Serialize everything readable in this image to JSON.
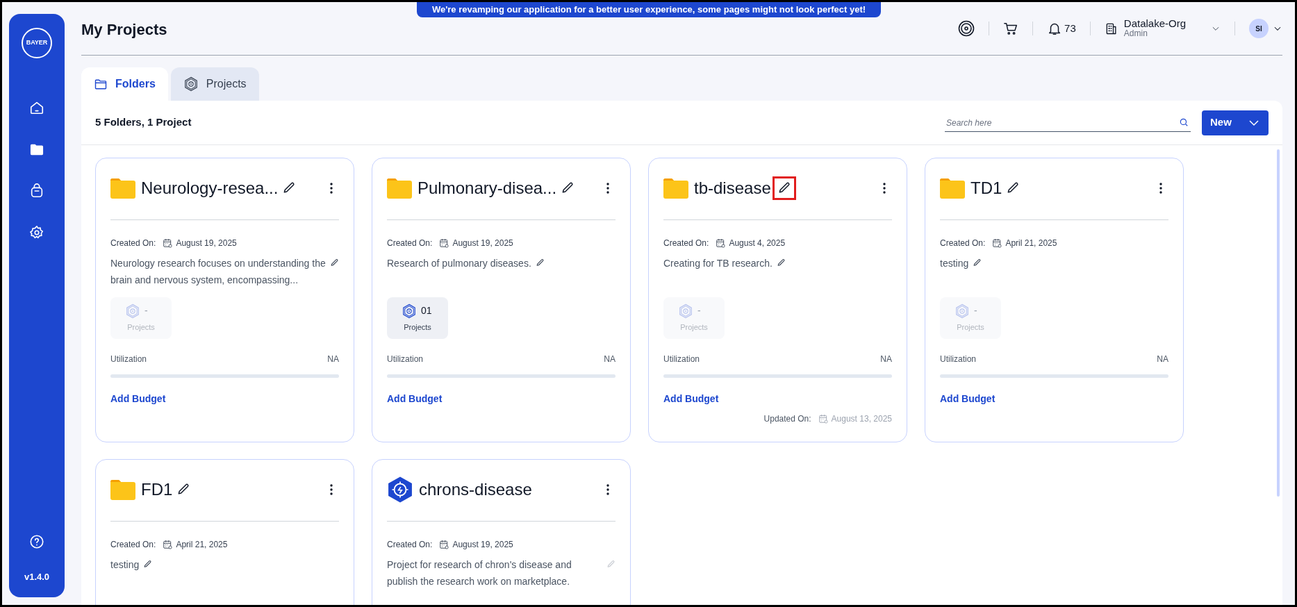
{
  "banner": "We're revamping our application for a better user experience, some pages might not look perfect yet!",
  "page_title": "My Projects",
  "header": {
    "notifications_count": "73",
    "org_name": "Datalake-Org",
    "org_role": "Admin",
    "avatar_initials": "SI"
  },
  "sidebar": {
    "logo": "BAYER",
    "version": "v1.4.0"
  },
  "tabs": [
    {
      "label": "Folders",
      "kind": "folder",
      "selected": true
    },
    {
      "label": "Projects",
      "kind": "project",
      "selected": false
    }
  ],
  "summary": "5 Folders, 1 Project",
  "search": {
    "placeholder": "Search here"
  },
  "new_button": "New",
  "cards": [
    {
      "kind": "folder",
      "title": "Neurology-resea...",
      "title_editable": true,
      "created_label": "Created On:",
      "created_date": "August 19, 2025",
      "description": "Neurology research focuses on understanding the brain and nervous system, encompassing...",
      "description_editable": true,
      "projects_count": "-",
      "projects_label": "Projects",
      "has_projects": false,
      "utilization_label": "Utilization",
      "utilization_value": "NA",
      "budget_link": "Add Budget"
    },
    {
      "kind": "folder",
      "title": "Pulmonary-disea...",
      "title_editable": true,
      "created_label": "Created On:",
      "created_date": "August 19, 2025",
      "description": "Research of pulmonary diseases.",
      "description_editable": true,
      "projects_count": "01",
      "projects_label": "Projects",
      "has_projects": true,
      "utilization_label": "Utilization",
      "utilization_value": "NA",
      "budget_link": "Add Budget"
    },
    {
      "kind": "folder",
      "title": "tb-disease",
      "title_editable": true,
      "highlighted": true,
      "created_label": "Created On:",
      "created_date": "August 4, 2025",
      "description": "Creating for TB research.",
      "description_editable": true,
      "projects_count": "-",
      "projects_label": "Projects",
      "has_projects": false,
      "utilization_label": "Utilization",
      "utilization_value": "NA",
      "budget_link": "Add Budget",
      "updated_label": "Updated On:",
      "updated_date": "August 13, 2025"
    },
    {
      "kind": "folder",
      "title": "TD1",
      "title_editable": true,
      "created_label": "Created On:",
      "created_date": "April 21, 2025",
      "description": "testing",
      "description_editable": true,
      "projects_count": "-",
      "projects_label": "Projects",
      "has_projects": false,
      "utilization_label": "Utilization",
      "utilization_value": "NA",
      "budget_link": "Add Budget"
    },
    {
      "kind": "folder",
      "title": "FD1",
      "title_editable": true,
      "created_label": "Created On:",
      "created_date": "April 21, 2025",
      "description": "testing",
      "description_editable": true
    },
    {
      "kind": "project",
      "title": "chrons-disease",
      "title_editable": false,
      "created_label": "Created On:",
      "created_date": "August 19, 2025",
      "description": "Project for research of chron's disease and publish the research work on marketplace.",
      "description_editable": false
    }
  ]
}
